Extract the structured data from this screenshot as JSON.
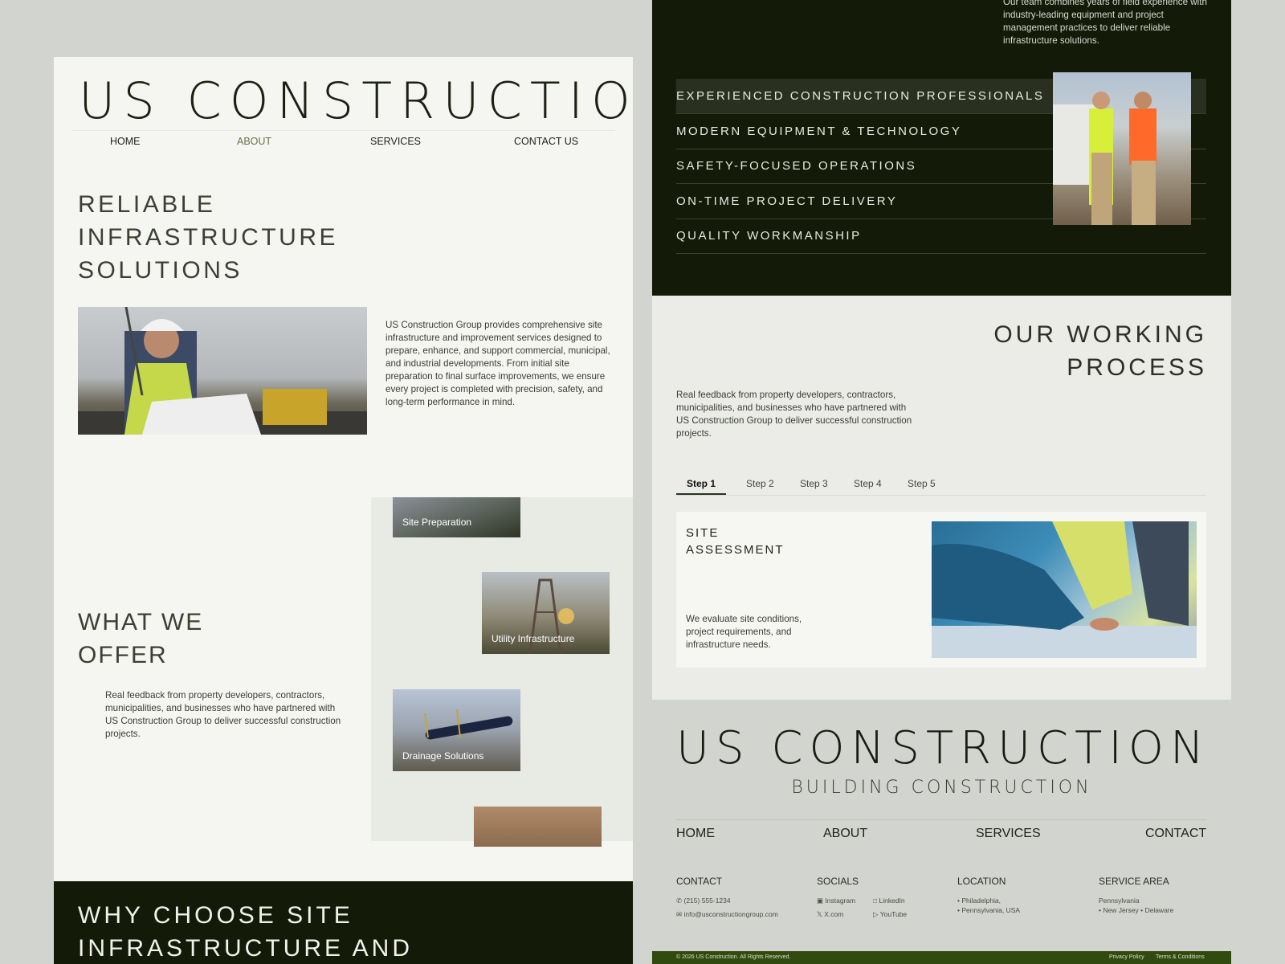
{
  "left": {
    "brand": "US CONSTRUCTION",
    "nav": [
      "HOME",
      "ABOUT",
      "SERVICES",
      "CONTACT US"
    ],
    "active_nav": "ABOUT",
    "hero_lines": [
      "RELIABLE",
      "INFRASTRUCTURE",
      "SOLUTIONS"
    ],
    "about_text": "US Construction Group provides comprehensive site infrastructure and improvement services designed to prepare, enhance, and support commercial, municipal, and industrial developments. From initial site preparation to final surface improvements, we ensure every project is completed with precision, safety, and long-term performance in mind.",
    "offer_lines": [
      "WHAT WE",
      "OFFER"
    ],
    "offer_text": "Real feedback from property developers, contractors, municipalities, and businesses who have partnered with US Construction Group to deliver successful construction projects.",
    "services": [
      "Site Preparation",
      "Utility Infrastructure",
      "Drainage Solutions"
    ],
    "why_lines": [
      "WHY CHOOSE SITE",
      "INFRASTRUCTURE AND"
    ]
  },
  "right": {
    "intro_text": "Our team combines years of field experience with industry-leading equipment and project management practices to deliver reliable infrastructure solutions.",
    "features": [
      "EXPERIENCED CONSTRUCTION PROFESSIONALS",
      "MODERN EQUIPMENT & TECHNOLOGY",
      "SAFETY-FOCUSED OPERATIONS",
      "ON-TIME PROJECT DELIVERY",
      "QUALITY WORKMANSHIP"
    ],
    "process_lines": [
      "OUR WORKING",
      "PROCESS"
    ],
    "process_text": "Real feedback from property developers, contractors, municipalities, and businesses who have partnered with US Construction Group to deliver successful construction projects.",
    "steps": [
      "Step 1",
      "Step 2",
      "Step 3",
      "Step 4",
      "Step 5"
    ],
    "active_step": "Step 1",
    "step_title_lines": [
      "SITE",
      "ASSESSMENT"
    ],
    "step_text": "We evaluate site conditions, project requirements, and infrastructure needs."
  },
  "footer": {
    "brand": "US CONSTRUCTION",
    "subtitle": "BUILDING CONSTRUCTION",
    "nav": [
      "HOME",
      "ABOUT",
      "SERVICES",
      "CONTACT"
    ],
    "contact_heading": "CONTACT",
    "phone": "(215) 555-1234",
    "email": "info@usconstructiongroup.com",
    "socials_heading": "SOCIALS",
    "socials": [
      "Instagram",
      "LinkedIn",
      "X.com",
      "YouTube"
    ],
    "location_heading": "LOCATION",
    "location": [
      "Philadelphia,",
      "Pennsylvania, USA"
    ],
    "service_area_heading": "SERVICE AREA",
    "service_area": [
      "Pennsylvania",
      "New Jersey",
      "Delaware"
    ],
    "copyright": "© 2026 US Construction. All Rights Reserved.",
    "privacy": "Privacy Policy",
    "terms": "Terms & Conditions"
  },
  "colors": {
    "dark": "#141a08",
    "light": "#f5f6f1",
    "accent_nav": "#6b7048",
    "footer_bar": "#314a0f"
  }
}
